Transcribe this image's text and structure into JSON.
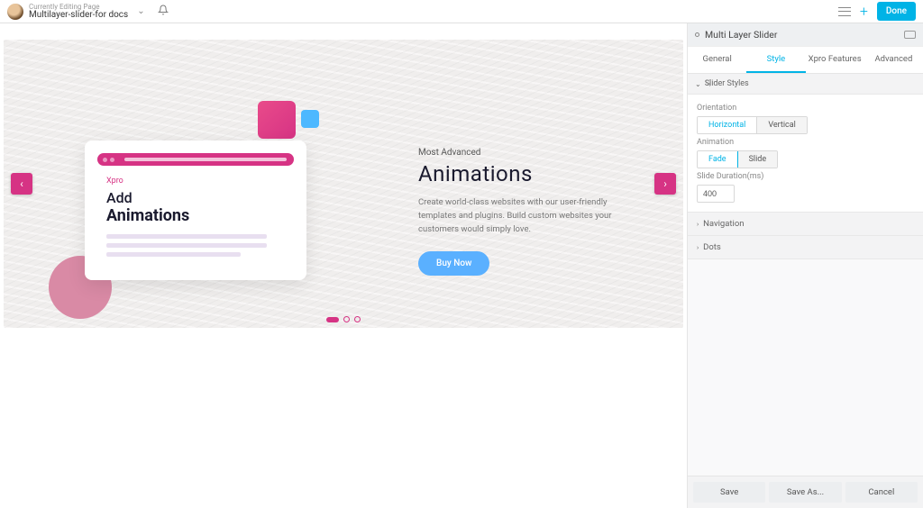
{
  "topbar": {
    "editing_label": "Currently Editing Page",
    "page_name": "Multilayer-slider-for docs",
    "done_label": "Done"
  },
  "slider": {
    "brand": "Xpro",
    "card_line1": "Add",
    "card_line2": "Animations",
    "hero_sub": "Most Advanced",
    "hero_title": "Animations",
    "hero_desc": "Create world-class websites with our user-friendly templates and plugins. Build custom websites your customers would simply love.",
    "buy_label": "Buy Now"
  },
  "panel": {
    "title": "Multi Layer Slider",
    "tabs": {
      "general": "General",
      "style": "Style",
      "xpro": "Xpro Features",
      "advanced": "Advanced"
    },
    "section_slider_styles": "Slider Styles",
    "orientation": {
      "label": "Orientation",
      "horizontal": "Horizontal",
      "vertical": "Vertical"
    },
    "animation": {
      "label": "Animation",
      "fade": "Fade",
      "slide": "Slide"
    },
    "duration": {
      "label": "Slide Duration(ms)",
      "value": "400"
    },
    "navigation": "Navigation",
    "dots": "Dots",
    "footer": {
      "save": "Save",
      "save_as": "Save As...",
      "cancel": "Cancel"
    }
  }
}
